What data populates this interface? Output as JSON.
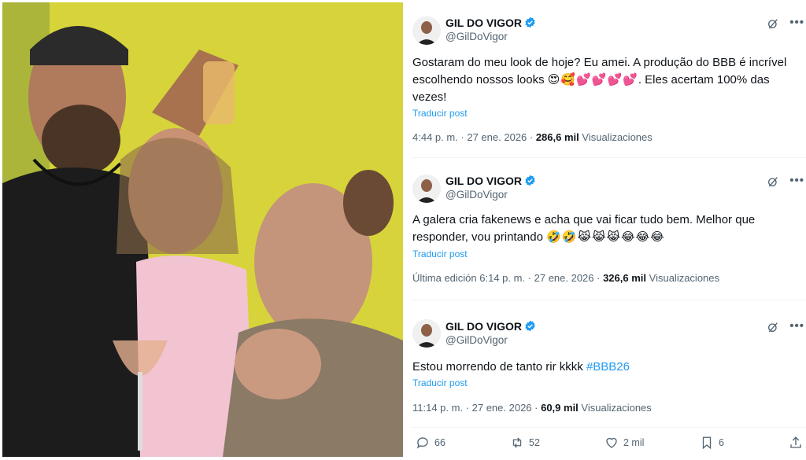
{
  "tweets": [
    {
      "name": "GIL DO VIGOR",
      "handle": "@GilDoVigor",
      "text": "Gostaram do meu look de hoje? Eu amei. A produção do BBB é incrível escolhendo nossos looks",
      "emojis": "😍🥰💕💕💕💕",
      "text_after": ". Eles acertam 100% das vezes!",
      "translate": "Traducir post",
      "meta_prefix": "4:44 p. m. · 27 ene. 2026 · ",
      "views": "286,6 mil",
      "views_label": "Visualizaciones"
    },
    {
      "name": "GIL DO VIGOR",
      "handle": "@GilDoVigor",
      "text": "A galera cria fakenews e acha que vai ficar tudo bem. Melhor que responder, vou printando",
      "emojis": "🤣🤣😹😹😹😂😂😂",
      "translate": "Traducir post",
      "meta_prefix": "Última edición 6:14 p. m. · 27 ene. 2026 · ",
      "views": "326,6 mil",
      "views_label": "Visualizaciones"
    },
    {
      "name": "GIL DO VIGOR",
      "handle": "@GilDoVigor",
      "text": "Estou morrendo de tanto rir kkkk",
      "hashtag": "#BBB26",
      "translate": "Traducir post",
      "meta_prefix": "11:14 p. m. · 27 ene. 2026 · ",
      "views": "60,9 mil",
      "views_label": "Visualizaciones"
    }
  ],
  "actions": {
    "replies": "66",
    "reposts": "52",
    "likes": "2 mil",
    "bookmarks": "6"
  },
  "icons": {
    "more": "•••",
    "verified": "verified-badge-icon",
    "grok": "grok-icon"
  },
  "colors": {
    "accent": "#1d9bf0",
    "muted": "#536471",
    "text": "#0f1419",
    "background_wall": "#d9d63a"
  }
}
